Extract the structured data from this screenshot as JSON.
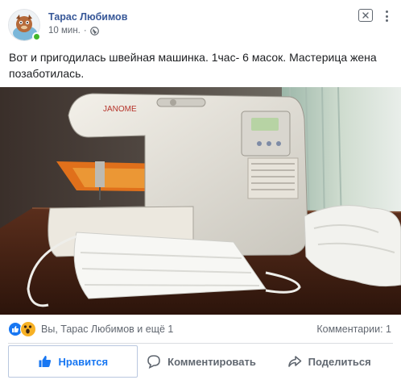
{
  "post": {
    "author": "Тарас Любимов",
    "time": "10 мин.",
    "separator": "·",
    "text": "Вот и пригодилась швейная машинка. 1час- 6 масок. Мастерица жена позаботилась.",
    "privacy_icon": "globe-icon"
  },
  "reactions": {
    "icons": [
      "like-reaction-icon",
      "wow-reaction-icon"
    ],
    "summary": "Вы, Тарас Любимов и ещё 1",
    "comments": "Комментарии: 1"
  },
  "actions": {
    "like": "Нравится",
    "comment": "Комментировать",
    "share": "Поделиться"
  },
  "colors": {
    "author_link": "#385898",
    "like_blue": "#1877f2",
    "online": "#42b72a",
    "wow_yellow": "#f7b125",
    "muted_text": "#616770"
  }
}
